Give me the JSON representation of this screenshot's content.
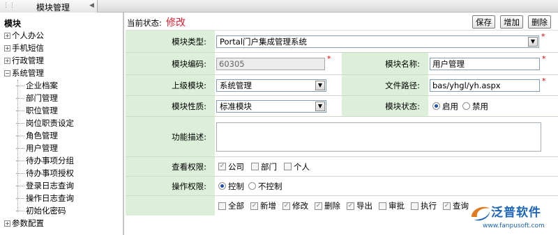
{
  "window": {
    "title": "模块管理"
  },
  "sidebar": {
    "root": "模块",
    "nodes": [
      {
        "label": "个人办公",
        "expander": "+"
      },
      {
        "label": "手机短信",
        "expander": "+"
      },
      {
        "label": "行政管理",
        "expander": "+"
      },
      {
        "label": "系统管理",
        "expander": "−"
      }
    ],
    "children": [
      "企业档案",
      "部门管理",
      "职位管理",
      "岗位职责设定",
      "角色管理",
      "用户管理",
      "待办事项分组",
      "待办事项授权",
      "登录日志查询",
      "操作日志查询",
      "初始化密码"
    ],
    "last_node": {
      "label": "参数配置",
      "expander": "+"
    }
  },
  "status": {
    "label": "当前状态:",
    "value": "修改"
  },
  "toolbar": {
    "save": "保存",
    "add": "增加",
    "delete": "删除"
  },
  "form": {
    "module_type": {
      "label": "模块类型:",
      "value": "Portal门户集成管理系统"
    },
    "module_code": {
      "label": "模块编码:",
      "value": "60305"
    },
    "module_name": {
      "label": "模块名称:",
      "value": "用户管理"
    },
    "parent_module": {
      "label": "上级模块:",
      "value": "系统管理"
    },
    "file_path": {
      "label": "文件路径:",
      "value": "bas/yhgl/yh.aspx"
    },
    "module_nature": {
      "label": "模块性质:",
      "value": "标准模块"
    },
    "module_status": {
      "label": "模块状态:",
      "options": [
        "启用",
        "禁用"
      ],
      "selected": "启用"
    },
    "description": {
      "label": "功能描述:",
      "value": ""
    },
    "view_permission": {
      "label": "查看权限:",
      "options": [
        {
          "label": "公司",
          "checked": true
        },
        {
          "label": "部门",
          "checked": false
        },
        {
          "label": "个人",
          "checked": false
        }
      ]
    },
    "operate_permission": {
      "label": "操作权限:",
      "options": [
        "控制",
        "不控制"
      ],
      "selected": "控制"
    },
    "operations": [
      {
        "label": "全部",
        "checked": false
      },
      {
        "label": "新增",
        "checked": true
      },
      {
        "label": "修改",
        "checked": true
      },
      {
        "label": "删除",
        "checked": true
      },
      {
        "label": "导出",
        "checked": true
      },
      {
        "label": "审批",
        "checked": false
      },
      {
        "label": "执行",
        "checked": false
      },
      {
        "label": "查询",
        "checked": true
      }
    ]
  },
  "logo": {
    "name": "泛普软件",
    "url": "www.fanpusoft.com"
  }
}
